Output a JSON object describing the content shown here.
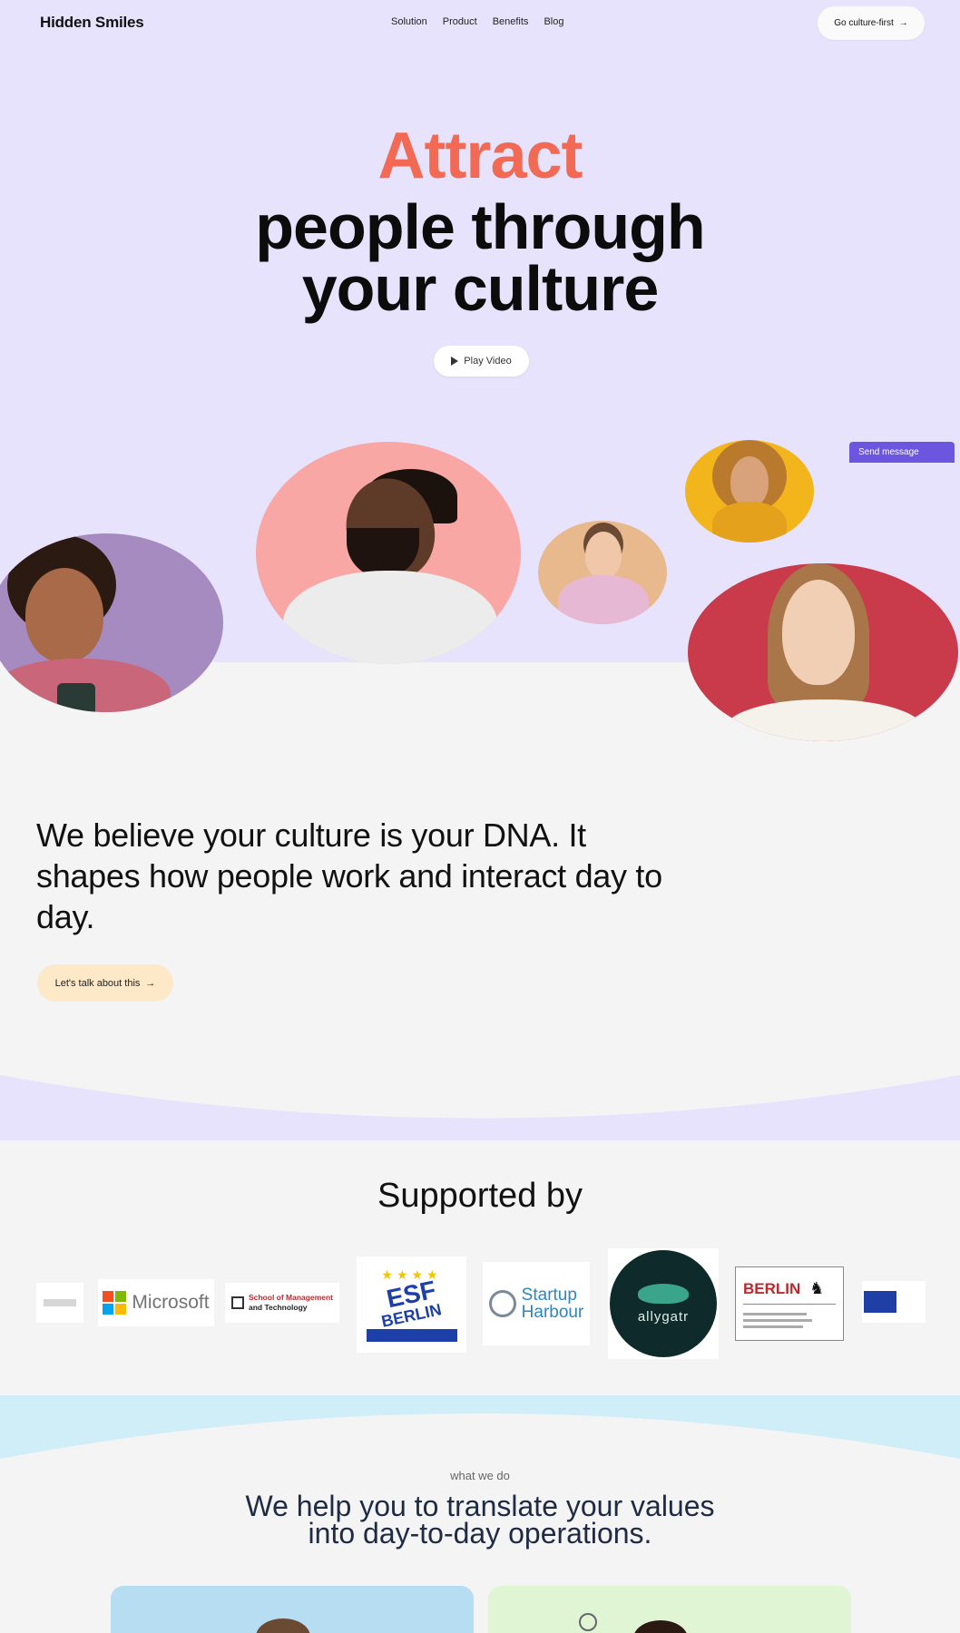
{
  "nav": {
    "logo": "Hidden Smiles",
    "links": [
      "Solution",
      "Product",
      "Benefits",
      "Blog"
    ],
    "cta": "Go culture-first"
  },
  "hero": {
    "headline_accent": "Attract",
    "headline_line1": "people through",
    "headline_line2": "your culture",
    "play_label": "Play Video",
    "send_message": "Send message"
  },
  "about": {
    "statement": "We believe your culture is your DNA. It shapes how people work and interact day to day.",
    "button": "Let's talk about this"
  },
  "supported": {
    "title": "Supported by",
    "logos": {
      "microsoft": "Microsoft",
      "school_line1": "School of Management",
      "school_line2": "and Technology",
      "esf_line1": "ESF",
      "esf_line2": "BERLIN",
      "harbour_line1": "Startup",
      "harbour_line2": "Harbour",
      "allygatr": "allygatr",
      "berlin": "BERLIN"
    }
  },
  "whatwedo": {
    "eyebrow": "what we do",
    "headline_line1": "We help you to translate your values",
    "headline_line2": "into day-to-day operations."
  },
  "colors": {
    "hero_bg": "#e8e3fd",
    "accent": "#f26a54",
    "send_message_bg": "#6c56e0",
    "talk_button_bg": "#fde8c8"
  }
}
